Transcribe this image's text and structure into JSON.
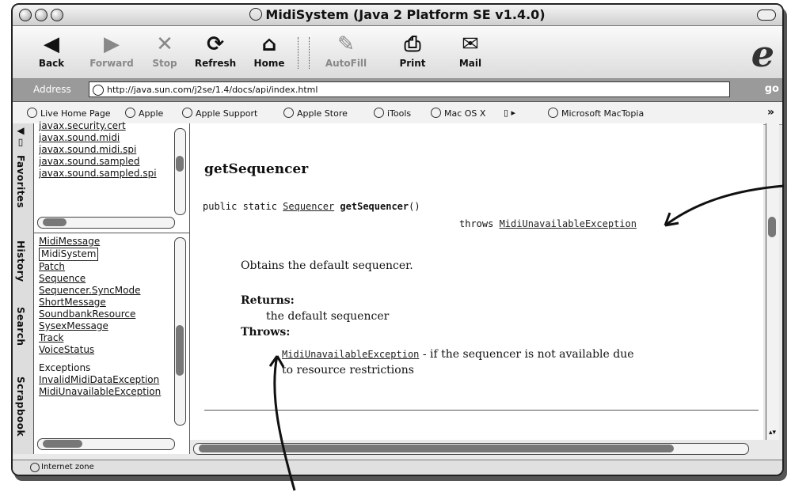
{
  "window": {
    "title": "MidiSystem (Java 2 Platform SE v1.4.0)"
  },
  "toolbar": {
    "buttons": [
      {
        "label": "Back",
        "icon": "back-arrow-icon",
        "glyph": "◀"
      },
      {
        "label": "Forward",
        "icon": "forward-arrow-icon",
        "glyph": "▶"
      },
      {
        "label": "Stop",
        "icon": "stop-x-icon",
        "glyph": "✕"
      },
      {
        "label": "Refresh",
        "icon": "refresh-icon",
        "glyph": "⟳"
      },
      {
        "label": "Home",
        "icon": "home-icon",
        "glyph": "⌂"
      },
      {
        "label": "AutoFill",
        "icon": "autofill-icon",
        "glyph": "✎"
      },
      {
        "label": "Print",
        "icon": "print-icon",
        "glyph": "⎙"
      },
      {
        "label": "Mail",
        "icon": "mail-icon",
        "glyph": "✉"
      }
    ]
  },
  "address": {
    "label": "Address",
    "value": "http://java.sun.com/j2se/1.4/docs/api/index.html",
    "go_label": "go"
  },
  "favorites": [
    "Live Home Page",
    "Apple",
    "Apple Support",
    "Apple Store",
    "iTools",
    "Mac OS X",
    "Microsoft MacTopia"
  ],
  "sidebar_tabs": [
    "Favorites",
    "History",
    "Search",
    "Scrapbook"
  ],
  "packages": [
    "javax.security.cert",
    "javax.sound.midi",
    "javax.sound.midi.spi",
    "javax.sound.sampled",
    "javax.sound.sampled.spi"
  ],
  "classes": [
    "MidiMessage",
    "MidiSystem",
    "Patch",
    "Sequence",
    "Sequencer.SyncMode",
    "ShortMessage",
    "SoundbankResource",
    "SysexMessage",
    "Track",
    "VoiceStatus"
  ],
  "selected_class": "MidiSystem",
  "exceptions_header": "Exceptions",
  "exceptions": [
    "InvalidMidiDataException",
    "MidiUnavailableException"
  ],
  "doc": {
    "method_name": "getSequencer",
    "signature_prefix": "public static ",
    "return_type": "Sequencer",
    "signature_name": "getSequencer",
    "signature_suffix": "()",
    "throws_keyword": "throws ",
    "throws_type": "MidiUnavailableException",
    "description": "Obtains the default sequencer.",
    "returns_label": "Returns:",
    "returns_text": "the default sequencer",
    "throws_label": "Throws:",
    "throws_exception": "MidiUnavailableException",
    "throws_text_1": " - if the sequencer is not available due",
    "throws_text_2": "to resource restrictions"
  },
  "status": {
    "text": "Internet zone"
  }
}
